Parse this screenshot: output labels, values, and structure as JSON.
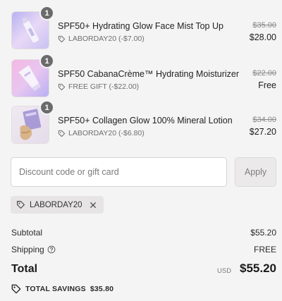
{
  "line_items": [
    {
      "quantity": "1",
      "name": "SPF50+ Hydrating Glow Face Mist Top Up",
      "discount": "LABORDAY20 (-$7.00)",
      "original_price": "$35.00",
      "price": "$28.00",
      "image": "face-mist-bottle"
    },
    {
      "quantity": "1",
      "name": "SPF50 CabanaCrème™ Hydrating Moisturizer",
      "discount": "FREE GIFT (-$22.00)",
      "original_price": "$22.00",
      "price": "Free",
      "image": "moisturizer-tube"
    },
    {
      "quantity": "1",
      "name": "SPF50+ Collagen Glow 100% Mineral Lotion",
      "discount": "LABORDAY20 (-$6.80)",
      "original_price": "$34.00",
      "price": "$27.20",
      "image": "mineral-lotion-box"
    }
  ],
  "discount_form": {
    "placeholder": "Discount code or gift card",
    "apply_label": "Apply"
  },
  "applied_code": "LABORDAY20",
  "summary": {
    "subtotal_label": "Subtotal",
    "subtotal_value": "$55.20",
    "shipping_label": "Shipping",
    "shipping_value": "FREE",
    "total_label": "Total",
    "currency": "USD",
    "total_value": "$55.20",
    "savings_label": "TOTAL SAVINGS",
    "savings_value": "$35.80"
  },
  "icons": {
    "tag": "tag-icon",
    "close": "close-icon",
    "help": "help-circle-icon",
    "savings": "tag-icon"
  },
  "colors": {
    "background": "#f5f4f4",
    "badge": "#6b6b6b",
    "muted_text": "#6f6f6f",
    "apply_button": "#ebe9e9"
  }
}
